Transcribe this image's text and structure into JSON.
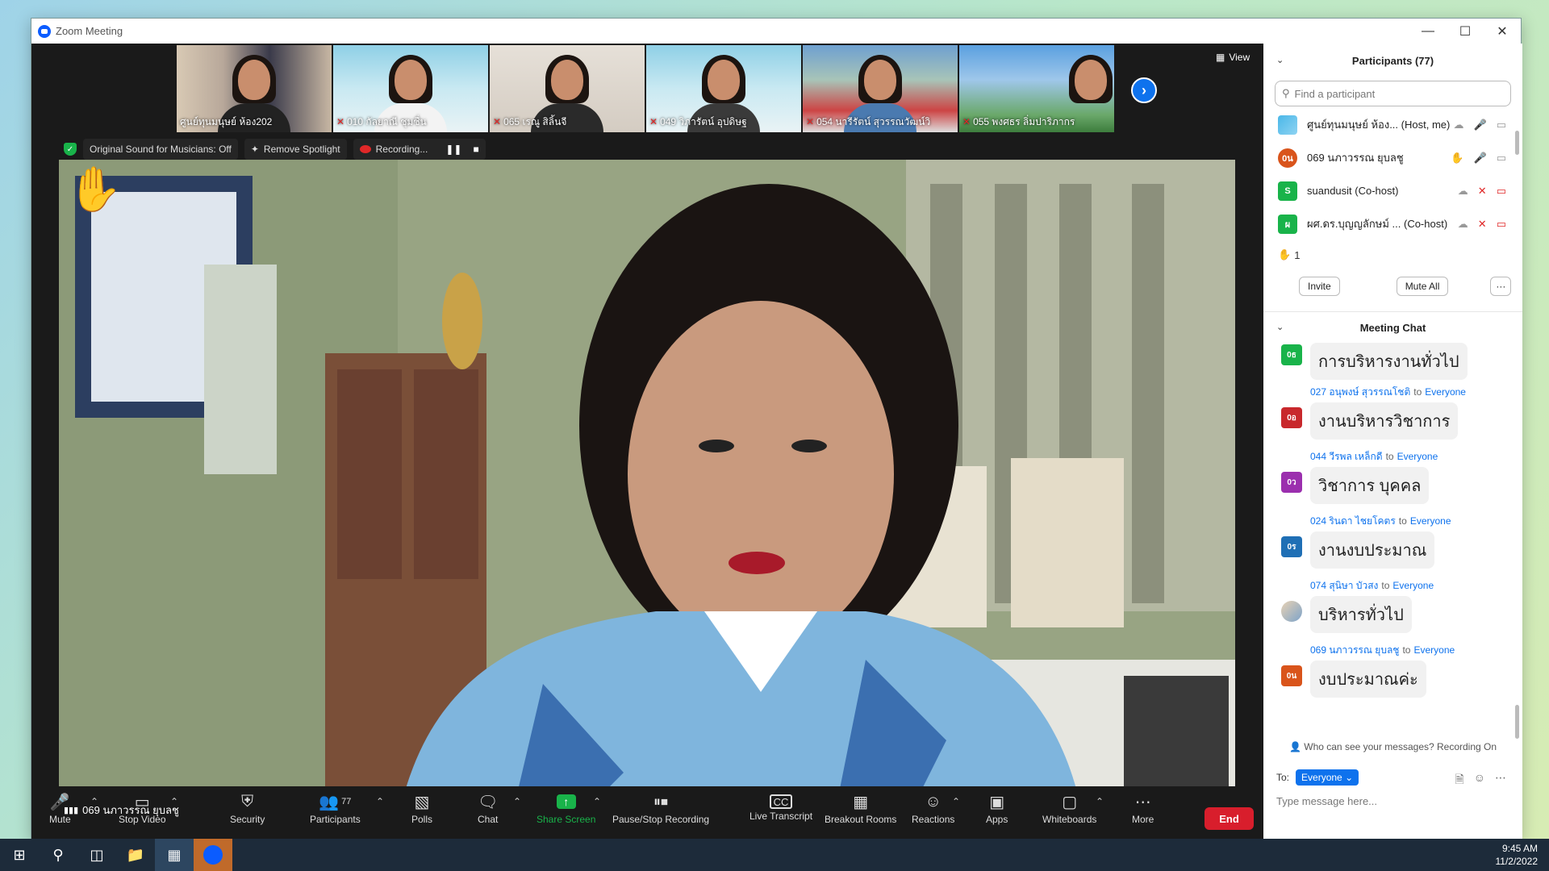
{
  "window": {
    "title": "Zoom Meeting"
  },
  "top_strip": {
    "view_label": "View",
    "thumbnails": [
      {
        "name": "ศูนย์ทุนมนุษย์ ห้อง202",
        "muted": false
      },
      {
        "name": "010 กัลยาณี  ชุมชื่น",
        "muted": true
      },
      {
        "name": "065 เรณู  สิลิ้นจี",
        "muted": true
      },
      {
        "name": "049 วิภารัตน์ อุปดิษฐ",
        "muted": true
      },
      {
        "name": "054 นารีรัตน์  สุวรรณวัฒน์วิ",
        "muted": true
      },
      {
        "name": "055 พงศธร ลิ่มปาริภากร",
        "muted": true
      }
    ]
  },
  "main_video": {
    "original_sound": "Original Sound for Musicians: Off",
    "remove_spotlight": "Remove Spotlight",
    "recording": "Recording...",
    "speaker_name": "069 นภาวรรณ ยุบลชู"
  },
  "toolbar": {
    "mute": "Mute",
    "stop_video": "Stop Video",
    "security": "Security",
    "participants": "Participants",
    "participants_count": "77",
    "polls": "Polls",
    "chat": "Chat",
    "share_screen": "Share Screen",
    "pause_stop_recording": "Pause/Stop Recording",
    "live_transcript": "Live Transcript",
    "breakout_rooms": "Breakout Rooms",
    "reactions": "Reactions",
    "apps": "Apps",
    "whiteboards": "Whiteboards",
    "more": "More",
    "end": "End"
  },
  "participants_panel": {
    "title": "Participants (77)",
    "search_placeholder": "Find a participant",
    "list": [
      {
        "avatar": "",
        "name": "ศูนย์ทุนมนุษย์ ห้อง...",
        "role": "(Host, me)"
      },
      {
        "avatar": "0น",
        "name": "069 นภาวรรณ ยุบลชู",
        "role": ""
      },
      {
        "avatar": "S",
        "name": "suandusit",
        "role": "(Co-host)"
      },
      {
        "avatar": "ผ",
        "name": "ผศ.ดร.บุญญลักษม์ ...",
        "role": "(Co-host)"
      }
    ],
    "raised_hands": "1",
    "invite": "Invite",
    "mute_all": "Mute All",
    "more": "···"
  },
  "chat_panel": {
    "title": "Meeting Chat",
    "messages": [
      {
        "avatar": "0ธ",
        "sender": "",
        "to": "",
        "recipient": "",
        "text": "การบริหารงานทั่วไป"
      },
      {
        "avatar": "0อ",
        "sender": "027 อนุพงษ์ สุวรรณโชติ",
        "to": "to",
        "recipient": "Everyone",
        "text": "งานบริหารวิชาการ"
      },
      {
        "avatar": "0ว",
        "sender": "044 วีรพล เหล็กดี",
        "to": "to",
        "recipient": "Everyone",
        "text": "วิชาการ บุคคล"
      },
      {
        "avatar": "0ร",
        "sender": "024 รินดา ไชยโคตร",
        "to": "to",
        "recipient": "Everyone",
        "text": "งานงบประมาณ"
      },
      {
        "avatar": "",
        "sender": "074 สุนิษา  บัวสง",
        "to": "to",
        "recipient": "Everyone",
        "text": "บริหารทั่วไป"
      },
      {
        "avatar": "0น",
        "sender": "069 นภาวรรณ ยุบลชู",
        "to": "to",
        "recipient": "Everyone",
        "text": "งบประมาณค่ะ"
      }
    ],
    "who_can_see": "Who can see your messages? Recording On",
    "to_label": "To:",
    "to_value": "Everyone",
    "input_placeholder": "Type message here..."
  },
  "taskbar": {
    "time": "9:45 AM",
    "date": "11/2/2022"
  },
  "colors": {
    "accent": "#0e72ed",
    "end": "#d81e2c",
    "share": "#19b34a"
  }
}
